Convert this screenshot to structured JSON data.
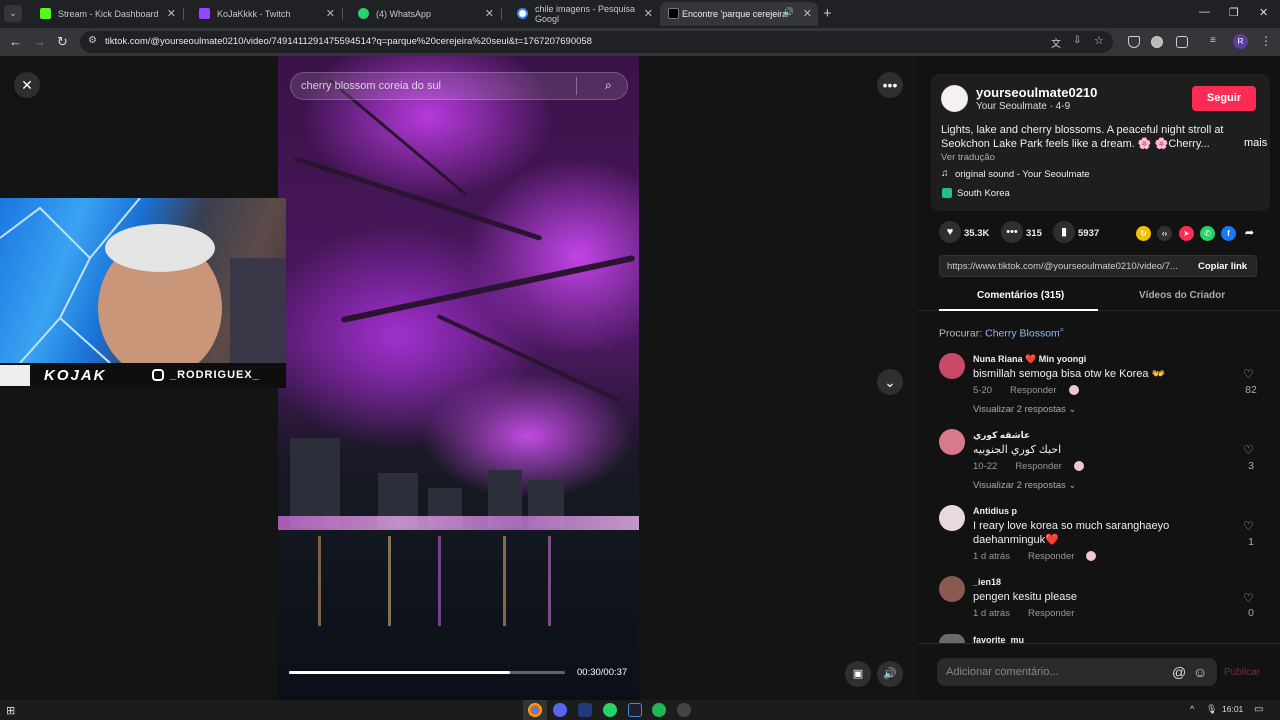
{
  "browser": {
    "tabs": [
      {
        "title": "Stream - Kick Dashboard",
        "favicon_color": "#53fc18"
      },
      {
        "title": "KoJaKkkk - Twitch",
        "favicon_color": "#9146ff"
      },
      {
        "title": "(4) WhatsApp",
        "favicon_color": "#25d366"
      },
      {
        "title": "chile imagens - Pesquisa Googl",
        "favicon_color": "#ffffff"
      },
      {
        "title": "Encontre 'parque cerejeira",
        "favicon_color": "#000000"
      }
    ],
    "url": "tiktok.com/@yourseoulmate0210/video/7491411291475594514?q=parque%20cerejeira%20seul&t=1767207690058",
    "profile_initial": "R"
  },
  "video": {
    "search_text": "cherry blossom coreia do sul",
    "progress_fraction": 0.8,
    "time": "00:30/00:37"
  },
  "webcam": {
    "logo": "KOJAK",
    "instagram": "_RODRIGUEX_"
  },
  "author": {
    "username": "yourseoulmate0210",
    "subtitle": "Your Seoulmate · 4-9",
    "follow_label": "Seguir",
    "description": "Lights, lake and cherry blossoms. A peaceful night stroll at Seokchon Lake Park feels like a dream. 🌸 🌸Cherry...",
    "more_label": "mais",
    "translate_label": "Ver tradução",
    "sound": "original sound - Your Seoulmate",
    "location": "South Korea"
  },
  "stats": {
    "likes": "35.3K",
    "comments": "315",
    "saves": "5937"
  },
  "link": {
    "url": "https://www.tiktok.com/@yourseoulmate0210/video/7...",
    "copy_label": "Copiar link"
  },
  "tabs": {
    "comments": "Comentários (315)",
    "creator_videos": "Vídeos do Criador"
  },
  "search_suggestion": {
    "label": "Procurar:",
    "term": "Cherry Blossom"
  },
  "comments": [
    {
      "name": "Nuna Riana ❤️ Min yoongi",
      "text": "bismillah semoga bisa otw ke Korea 👐",
      "date": "5-20",
      "reply": "Responder",
      "view": "Visualizar 2 respostas",
      "likes": "82",
      "avatar_color": "#c94a67"
    },
    {
      "name": "عاشقه كوري",
      "text": "احبك كوري الجنوبيه",
      "date": "10-22",
      "reply": "Responder",
      "view": "Visualizar 2 respostas",
      "likes": "3",
      "avatar_color": "#d87a8a"
    },
    {
      "name": "Antidius p",
      "text": "I reary love korea so much saranghaeyo daehanminguk❤️",
      "date": "1 d atrás",
      "reply": "Responder",
      "view": "",
      "likes": "1",
      "avatar_color": "#e8d9e0"
    },
    {
      "name": "_ien18",
      "text": "pengen kesitu please",
      "date": "1 d atrás",
      "reply": "Responder",
      "view": "",
      "likes": "0",
      "avatar_color": "#8a5a50"
    },
    {
      "name": "favorite_mu",
      "text": "",
      "date": "",
      "reply": "",
      "view": "",
      "likes": "",
      "avatar_color": "#6a6a6a"
    }
  ],
  "comment_input": {
    "placeholder": "Adicionar comentário...",
    "post_label": "Publicar"
  },
  "taskbar": {
    "time": "16:01"
  }
}
